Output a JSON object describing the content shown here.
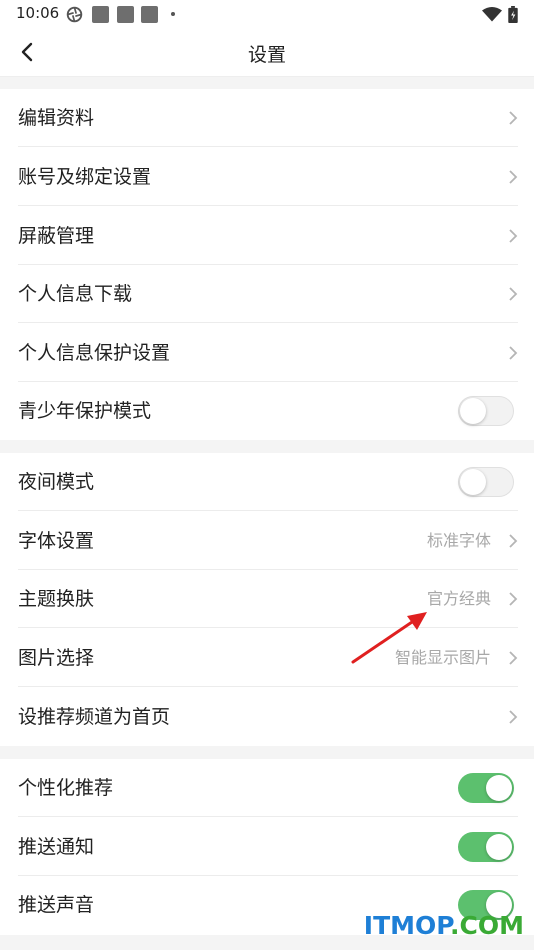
{
  "status_bar": {
    "time": "10:06"
  },
  "header": {
    "title": "设置"
  },
  "sections": {
    "account": [
      {
        "label": "编辑资料",
        "control": "chevron"
      },
      {
        "label": "账号及绑定设置",
        "control": "chevron"
      },
      {
        "label": "屏蔽管理",
        "control": "chevron"
      },
      {
        "label": "个人信息下载",
        "control": "chevron"
      },
      {
        "label": "个人信息保护设置",
        "control": "chevron"
      },
      {
        "label": "青少年保护模式",
        "control": "toggle",
        "on": false
      }
    ],
    "display": [
      {
        "label": "夜间模式",
        "control": "toggle",
        "on": false
      },
      {
        "label": "字体设置",
        "value": "标准字体",
        "control": "chevron"
      },
      {
        "label": "主题换肤",
        "value": "官方经典",
        "control": "chevron"
      },
      {
        "label": "图片选择",
        "value": "智能显示图片",
        "control": "chevron"
      },
      {
        "label": "设推荐频道为首页",
        "control": "chevron"
      }
    ],
    "notifications": [
      {
        "label": "个性化推荐",
        "control": "toggle",
        "on": true
      },
      {
        "label": "推送通知",
        "control": "toggle",
        "on": true
      },
      {
        "label": "推送声音",
        "control": "toggle",
        "on": true
      }
    ]
  },
  "colors": {
    "toggle_on": "#5cc06e",
    "annotation_arrow": "#e02020",
    "watermark_blue": "#1e7fd6",
    "watermark_green": "#3aaa35"
  },
  "icons": {
    "back": "chevron-left-icon",
    "row_arrow": "chevron-right-icon",
    "wifi": "wifi-icon",
    "battery": "battery-icon"
  },
  "watermark": {
    "part1": "ITMOP",
    "part2": ".COM"
  }
}
